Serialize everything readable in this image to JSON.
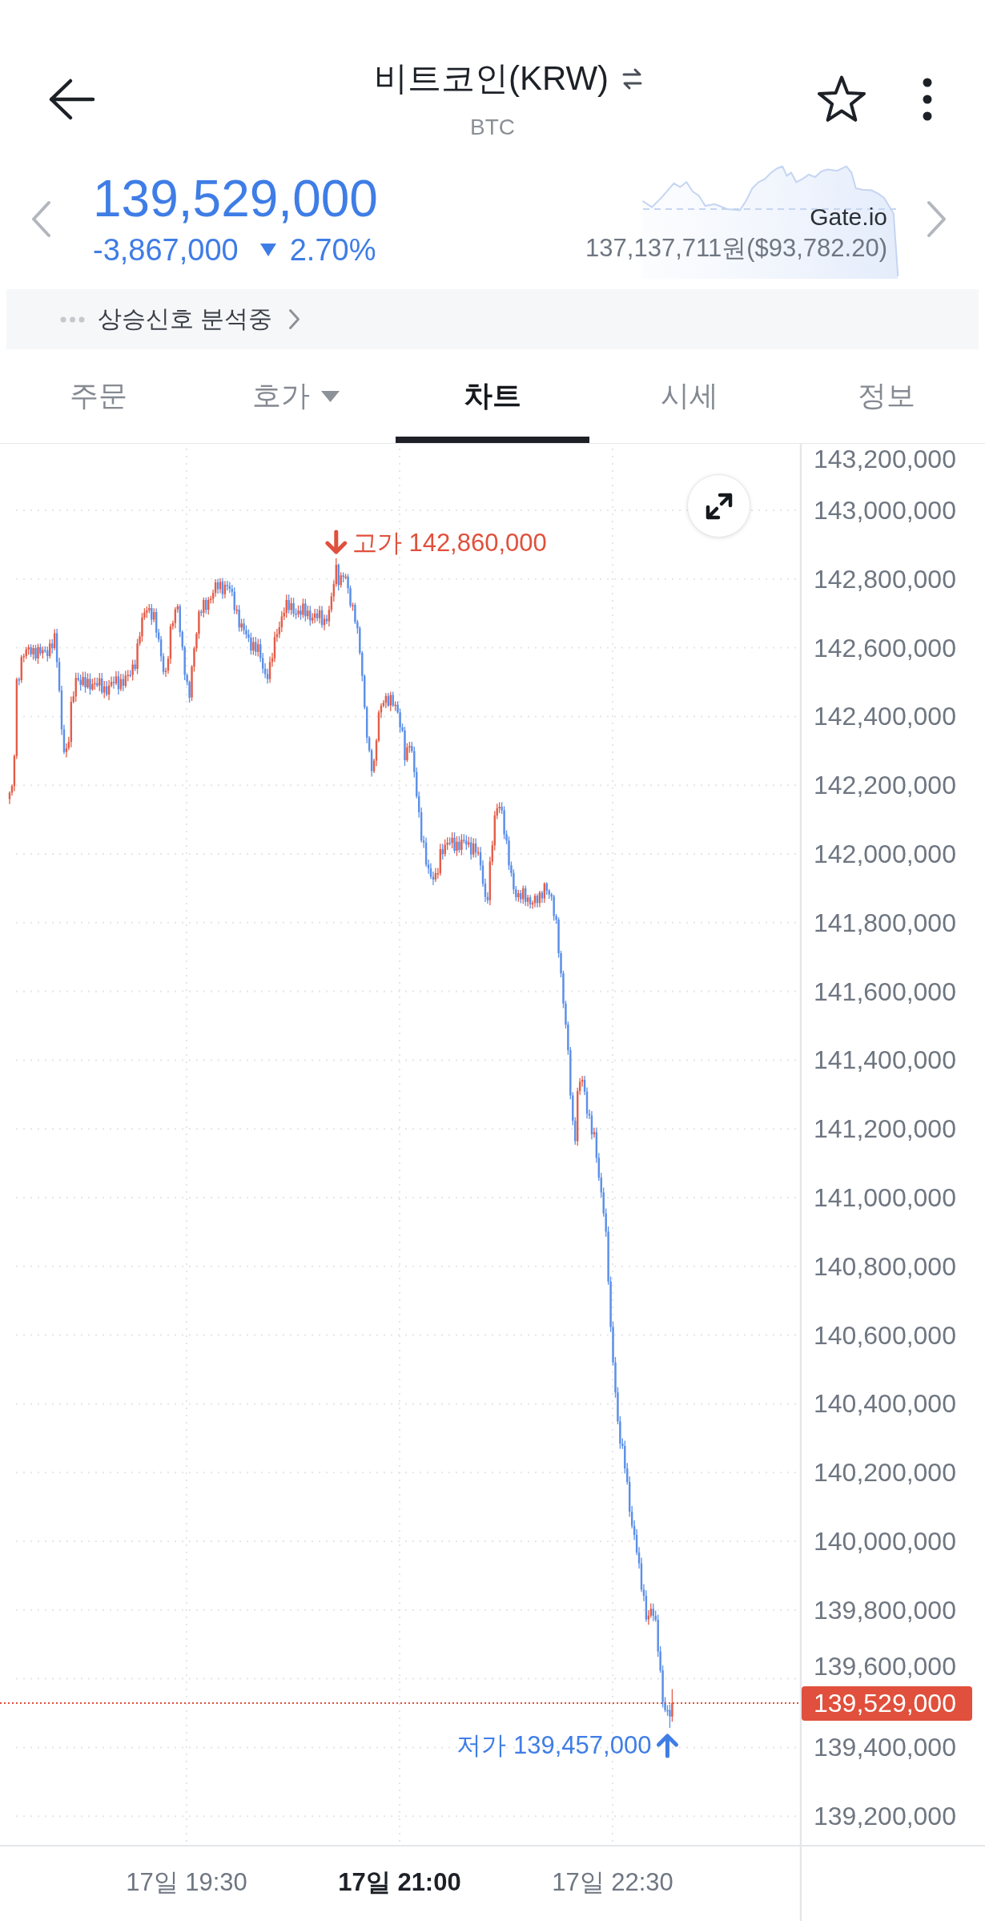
{
  "app_bar": {
    "title": "비트코인(KRW)",
    "symbol": "BTC",
    "favorite": false
  },
  "ticker": {
    "price": "139,529,000",
    "change": "-3,867,000",
    "change_rate": "2.70%",
    "falling": true,
    "exchange": {
      "name": "Gate.io",
      "price": "137,137,711원($93,782.20)"
    }
  },
  "signal_banner": {
    "text": "상승신호 분석중"
  },
  "tabs": [
    {
      "label": "주문",
      "kind": "plain",
      "selected": false
    },
    {
      "label": "호가",
      "kind": "menu",
      "selected": false
    },
    {
      "label": "차트",
      "kind": "plain",
      "selected": true
    },
    {
      "label": "시세",
      "kind": "plain",
      "selected": false
    },
    {
      "label": "정보",
      "kind": "plain",
      "selected": false
    }
  ],
  "chart": {
    "price_labels": [
      "143,200,000",
      "143,000,000",
      "142,800,000",
      "142,600,000",
      "142,400,000",
      "142,200,000",
      "142,000,000",
      "141,800,000",
      "141,600,000",
      "141,400,000",
      "141,200,000",
      "141,000,000",
      "140,800,000",
      "140,600,000",
      "140,400,000",
      "140,200,000",
      "140,000,000",
      "139,800,000",
      "139,600,000",
      "139,400,000",
      "139,200,000"
    ],
    "current_price": "139,529,000",
    "high_marker": "고가 142,860,000",
    "low_marker": "저가 139,457,000",
    "time_labels": [
      {
        "label": "17일 19:30",
        "emphasized": false
      },
      {
        "label": "17일 21:00",
        "emphasized": true
      },
      {
        "label": "17일 22:30",
        "emphasized": false
      }
    ]
  }
}
